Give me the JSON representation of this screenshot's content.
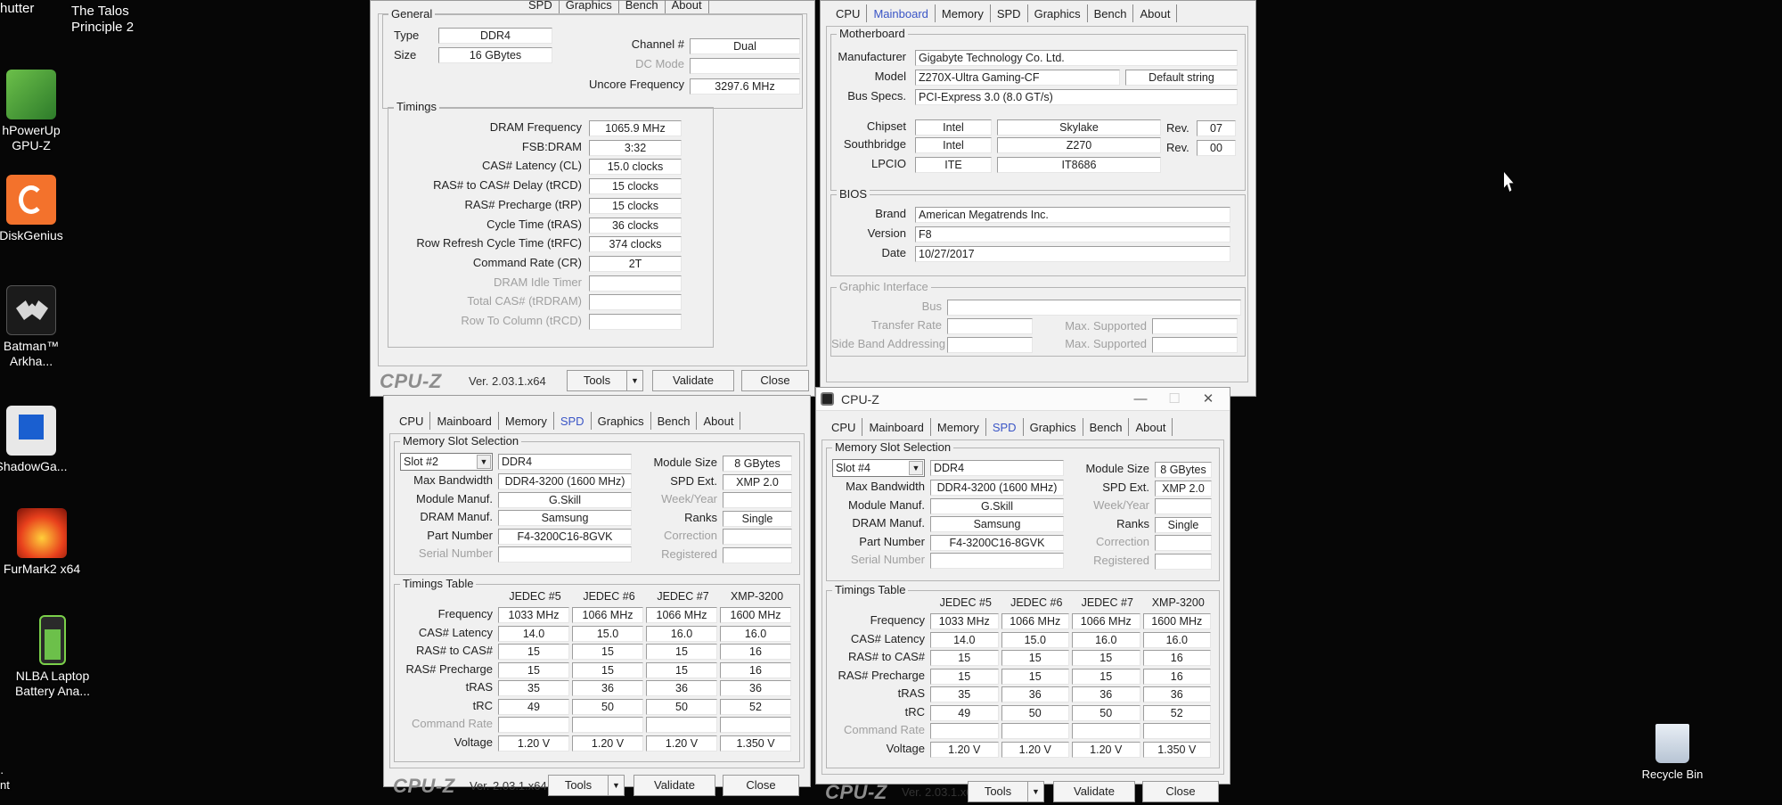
{
  "desktop": {
    "top_left_text": "hutter",
    "talos": [
      "The Talos",
      "Principle 2"
    ],
    "icons": [
      {
        "l1": "hPowerUp",
        "l2": "GPU-Z"
      },
      {
        "l1": "DiskGenius",
        "l2": ""
      },
      {
        "l1": "Batman™",
        "l2": "Arkha..."
      },
      {
        "l1": "ShadowGa...",
        "l2": ""
      },
      {
        "l1": "FurMark2 x64",
        "l2": ""
      },
      {
        "l1": "NLBA Laptop",
        "l2": "Battery Ana..."
      }
    ],
    "recycle_bin": "Recycle Bin",
    "bottom_left": [
      "·",
      "nt"
    ]
  },
  "tabs": [
    "CPU",
    "Mainboard",
    "Memory",
    "SPD",
    "Graphics",
    "Bench",
    "About"
  ],
  "memory_window": {
    "general_title": "General",
    "type_label": "Type",
    "type": "DDR4",
    "size_label": "Size",
    "size": "16 GBytes",
    "channel_label": "Channel #",
    "channel": "Dual",
    "dcmode_label": "DC Mode",
    "dcmode": "",
    "uncore_label": "Uncore Frequency",
    "uncore": "3297.6 MHz",
    "timings_title": "Timings",
    "timings": [
      {
        "label": "DRAM Frequency",
        "value": "1065.9 MHz",
        "dim": false
      },
      {
        "label": "FSB:DRAM",
        "value": "3:32",
        "dim": false
      },
      {
        "label": "CAS# Latency (CL)",
        "value": "15.0 clocks",
        "dim": false
      },
      {
        "label": "RAS# to CAS# Delay (tRCD)",
        "value": "15 clocks",
        "dim": false
      },
      {
        "label": "RAS# Precharge (tRP)",
        "value": "15 clocks",
        "dim": false
      },
      {
        "label": "Cycle Time (tRAS)",
        "value": "36 clocks",
        "dim": false
      },
      {
        "label": "Row Refresh Cycle Time (tRFC)",
        "value": "374 clocks",
        "dim": false
      },
      {
        "label": "Command Rate (CR)",
        "value": "2T",
        "dim": false
      },
      {
        "label": "DRAM Idle Timer",
        "value": "",
        "dim": true
      },
      {
        "label": "Total CAS# (tRDRAM)",
        "value": "",
        "dim": true
      },
      {
        "label": "Row To Column (tRCD)",
        "value": "",
        "dim": true
      }
    ]
  },
  "mainboard_window": {
    "motherboard_title": "Motherboard",
    "manufacturer_label": "Manufacturer",
    "manufacturer": "Gigabyte Technology Co. Ltd.",
    "model_label": "Model",
    "model": "Z270X-Ultra Gaming-CF",
    "model_extra": "Default string",
    "bus_label": "Bus Specs.",
    "bus": "PCI-Express 3.0 (8.0 GT/s)",
    "chipset_label": "Chipset",
    "chipset_vendor": "Intel",
    "chipset_name": "Skylake",
    "chipset_rev_label": "Rev.",
    "chipset_rev": "07",
    "south_label": "Southbridge",
    "south_vendor": "Intel",
    "south_name": "Z270",
    "south_rev_label": "Rev.",
    "south_rev": "00",
    "lpcio_label": "LPCIO",
    "lpcio_vendor": "ITE",
    "lpcio_name": "IT8686",
    "bios_title": "BIOS",
    "brand_label": "Brand",
    "brand": "American Megatrends Inc.",
    "version_label": "Version",
    "version": "F8",
    "date_label": "Date",
    "date": "10/27/2017",
    "gi_title": "Graphic Interface",
    "gi_bus_label": "Bus",
    "gi_rate_label": "Transfer Rate",
    "gi_max1_label": "Max. Supported",
    "gi_side_label": "Side Band Addressing",
    "gi_max2_label": "Max. Supported"
  },
  "spd_common": {
    "slot_title": "Memory Slot Selection",
    "maxbw_label": "Max Bandwidth",
    "modmanuf_label": "Module Manuf.",
    "drammanuf_label": "DRAM Manuf.",
    "part_label": "Part Number",
    "serial_label": "Serial Number",
    "modsize_label": "Module Size",
    "spdext_label": "SPD Ext.",
    "week_label": "Week/Year",
    "ranks_label": "Ranks",
    "correction_label": "Correction",
    "registered_label": "Registered",
    "timings_title": "Timings Table",
    "columns": [
      "JEDEC #5",
      "JEDEC #6",
      "JEDEC #7",
      "XMP-3200"
    ],
    "rows": [
      {
        "label": "Frequency",
        "values": [
          "1033 MHz",
          "1066 MHz",
          "1066 MHz",
          "1600 MHz"
        ],
        "dim": false
      },
      {
        "label": "CAS# Latency",
        "values": [
          "14.0",
          "15.0",
          "16.0",
          "16.0"
        ],
        "dim": false
      },
      {
        "label": "RAS# to CAS#",
        "values": [
          "15",
          "15",
          "15",
          "16"
        ],
        "dim": false
      },
      {
        "label": "RAS# Precharge",
        "values": [
          "15",
          "15",
          "15",
          "16"
        ],
        "dim": false
      },
      {
        "label": "tRAS",
        "values": [
          "35",
          "36",
          "36",
          "36"
        ],
        "dim": false
      },
      {
        "label": "tRC",
        "values": [
          "49",
          "50",
          "50",
          "52"
        ],
        "dim": false
      },
      {
        "label": "Command Rate",
        "values": [
          "",
          "",
          "",
          ""
        ],
        "dim": true
      },
      {
        "label": "Voltage",
        "values": [
          "1.20 V",
          "1.20 V",
          "1.20 V",
          "1.350 V"
        ],
        "dim": false
      }
    ]
  },
  "spd_left": {
    "slot": "Slot #2",
    "type": "DDR4",
    "maxbw": "DDR4-3200 (1600 MHz)",
    "modmanuf": "G.Skill",
    "drammanuf": "Samsung",
    "part": "F4-3200C16-8GVK",
    "serial": "",
    "modsize": "8 GBytes",
    "spdext": "XMP 2.0",
    "week": "",
    "ranks": "Single",
    "correction": "",
    "registered": ""
  },
  "spd_right": {
    "title": "CPU-Z",
    "slot": "Slot #4",
    "type": "DDR4",
    "maxbw": "DDR4-3200 (1600 MHz)",
    "modmanuf": "G.Skill",
    "drammanuf": "Samsung",
    "part": "F4-3200C16-8GVK",
    "serial": "",
    "modsize": "8 GBytes",
    "spdext": "XMP 2.0",
    "week": "",
    "ranks": "Single",
    "correction": "",
    "registered": ""
  },
  "footer": {
    "brand": "CPU-Z",
    "version": "Ver. 2.03.1.x64",
    "tools": "Tools",
    "validate": "Validate",
    "close": "Close"
  }
}
